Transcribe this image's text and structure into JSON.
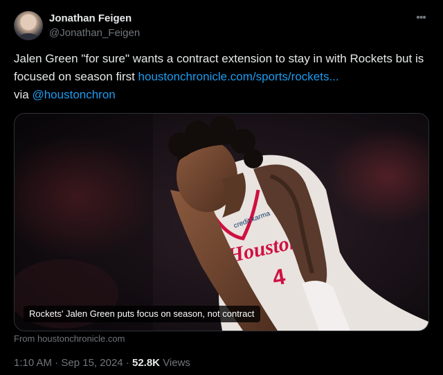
{
  "author": {
    "name": "Jonathan Feigen",
    "handle": "@Jonathan_Feigen"
  },
  "more_icon": "more-icon",
  "tweet": {
    "text_part1": "Jalen Green \"for sure\" wants a contract extension to stay in with Rockets but is focused on season first ",
    "link_text": "houstonchronicle.com/sports/rockets...",
    "via_text": "via ",
    "mention": "@houstonchron"
  },
  "card": {
    "caption": "Rockets' Jalen Green puts focus on season, not contract",
    "source": "From houstonchronicle.com"
  },
  "meta": {
    "time": "1:10 AM",
    "date": "Sep 15, 2024",
    "views_count": "52.8K",
    "views_label": "Views",
    "separator": "·"
  },
  "colors": {
    "background": "#000000",
    "text": "#e7e9ea",
    "secondary": "#71767b",
    "link": "#1d9bf0",
    "jersey_red": "#ce1141"
  }
}
